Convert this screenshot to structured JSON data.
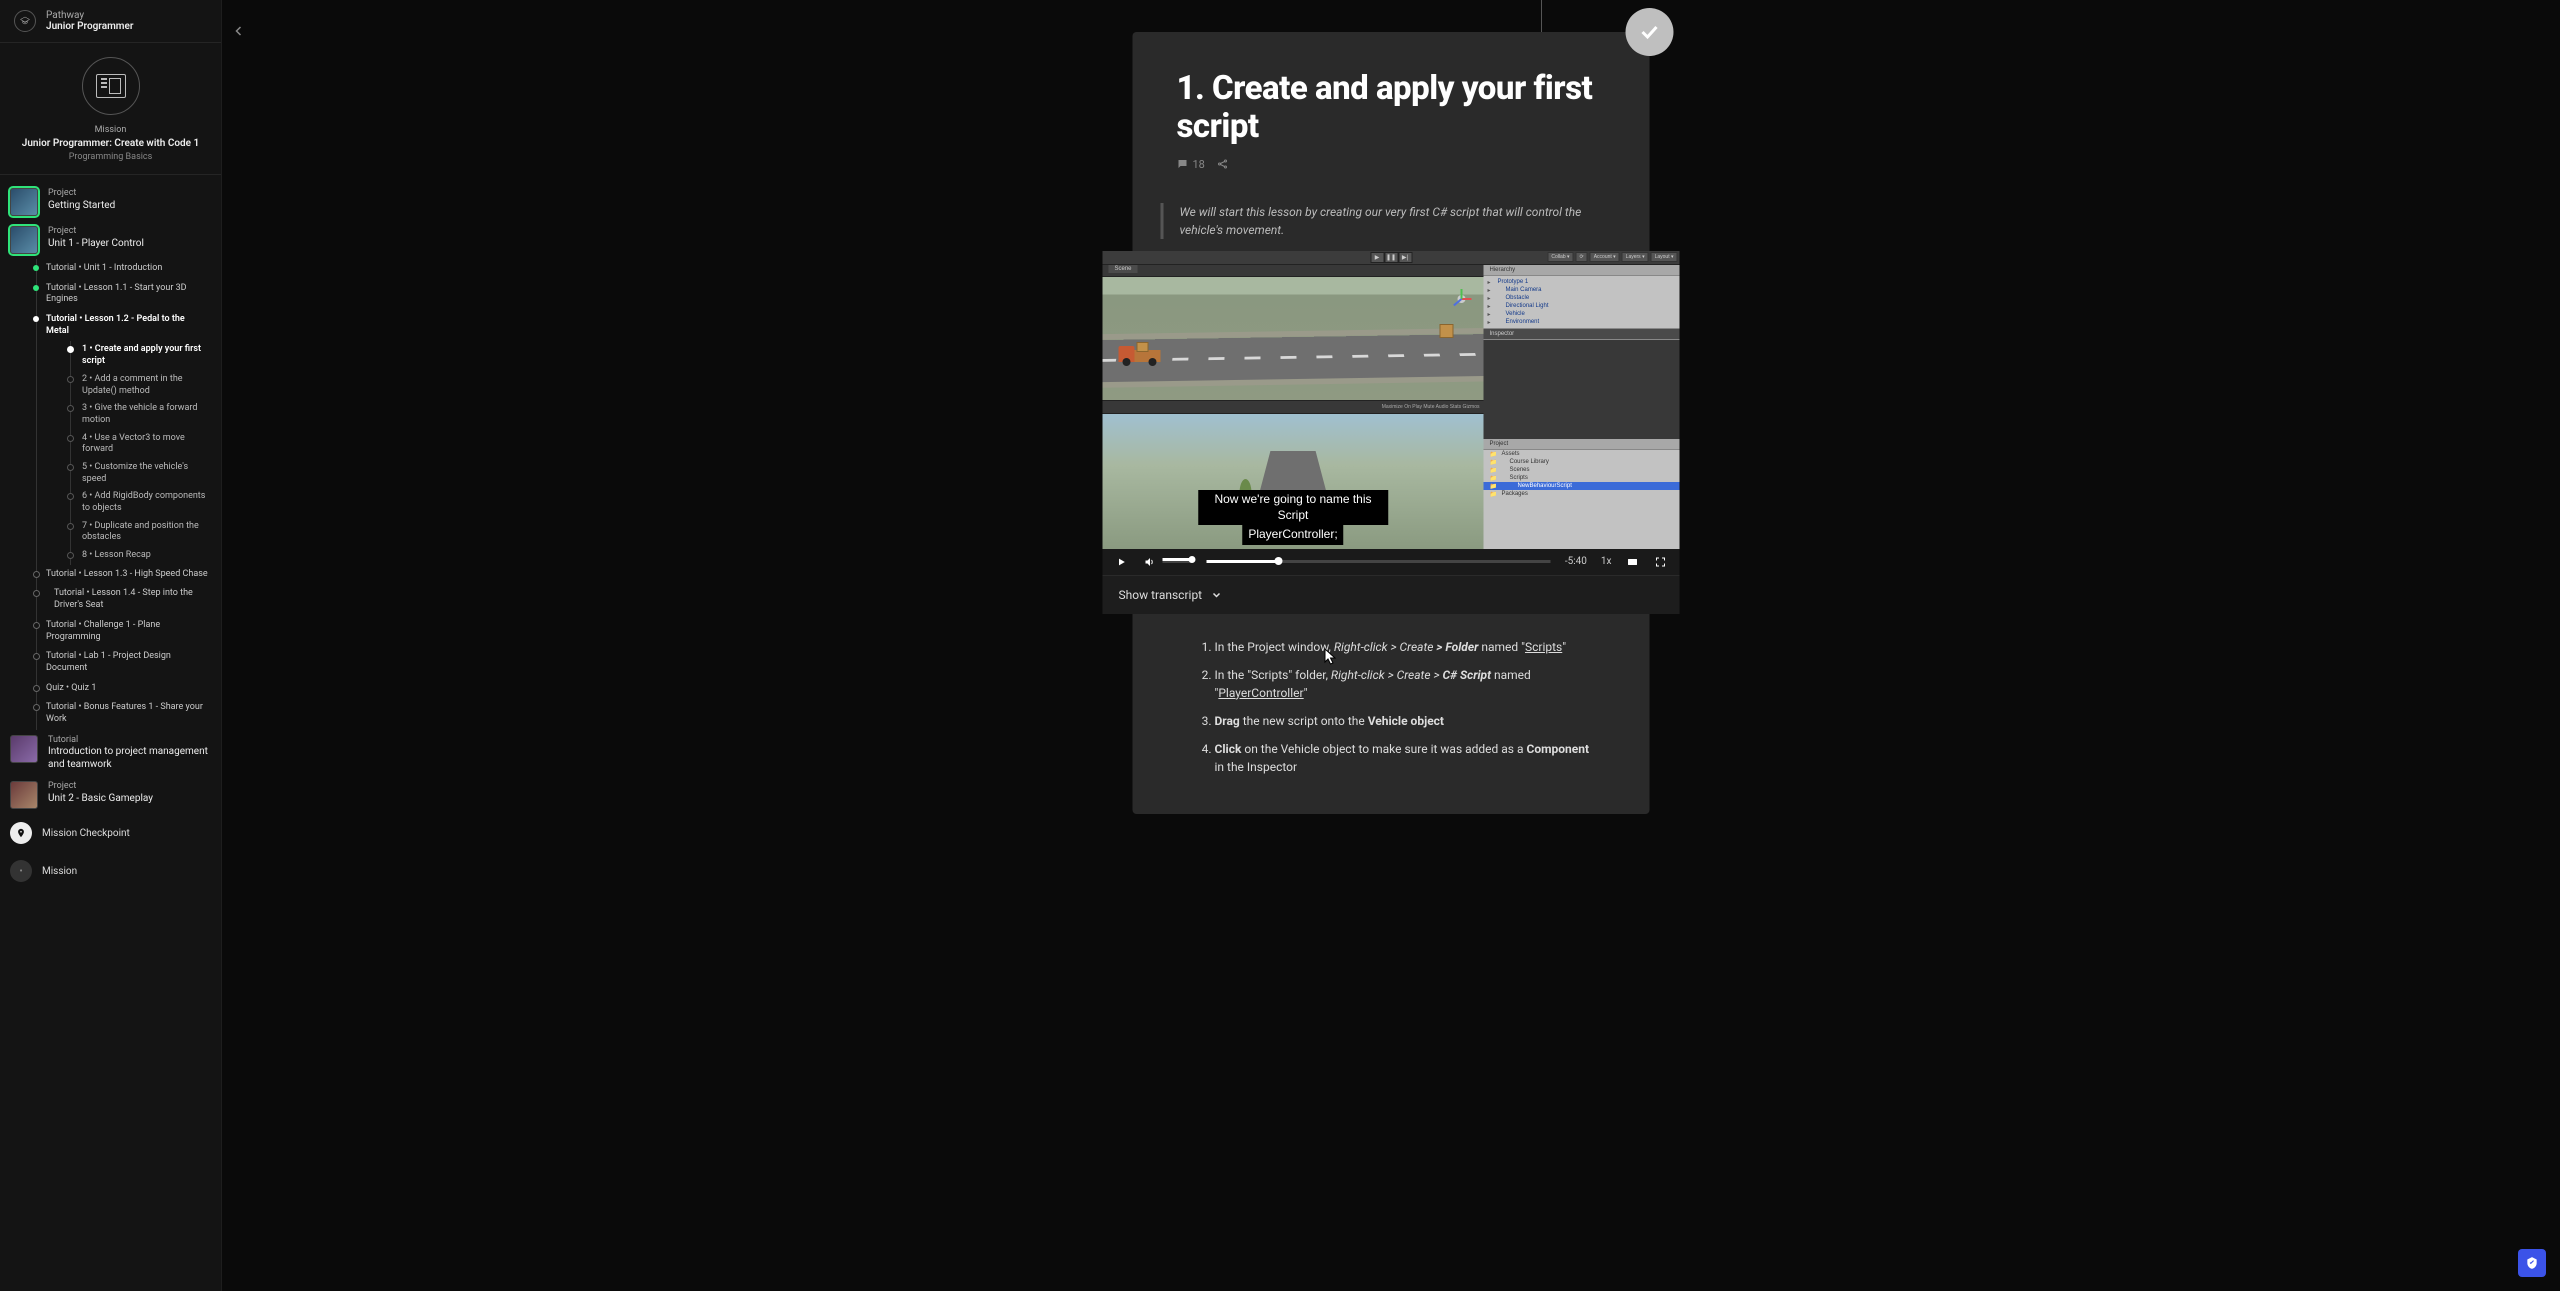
{
  "sidebar": {
    "pathway_label": "Pathway",
    "pathway_name": "Junior Programmer",
    "mission_label": "Mission",
    "mission_title": "Junior Programmer: Create with Code 1",
    "mission_sub": "Programming Basics",
    "nodes": {
      "getting_started": {
        "kind": "Project",
        "title": "Getting Started"
      },
      "unit1": {
        "kind": "Project",
        "title": "Unit 1 - Player Control"
      },
      "intro_pm": {
        "kind": "Tutorial",
        "title": "Introduction to project management and teamwork"
      },
      "unit2": {
        "kind": "Project",
        "title": "Unit 2 - Basic Gameplay"
      },
      "checkpoint": "Mission Checkpoint",
      "next_mission": "Mission"
    },
    "lessons": {
      "l0": "Tutorial • Unit 1 - Introduction",
      "l1": "Tutorial • Lesson 1.1 - Start your 3D Engines",
      "l2": "Tutorial • Lesson 1.2 - Pedal to the Metal",
      "l3": "Tutorial • Lesson 1.3 - High Speed Chase",
      "l4": "Tutorial • Lesson 1.4 - Step into the Driver's Seat",
      "l5": "Tutorial • Challenge 1 - Plane Programming",
      "l6": "Tutorial • Lab 1 - Project Design Document",
      "l7": "Quiz • Quiz 1",
      "l8": "Tutorial • Bonus Features 1 - Share your Work"
    },
    "steps": {
      "s1": "1 • Create and apply your first script",
      "s2": "2 • Add a comment in the Update() method",
      "s3": "3 • Give the vehicle a forward motion",
      "s4": "4 • Use a Vector3 to move forward",
      "s5": "5 • Customize the vehicle's speed",
      "s6": "6 • Add RigidBody components to objects",
      "s7": "7 • Duplicate and position the obstacles",
      "s8": "8 • Lesson Recap"
    }
  },
  "main": {
    "title": "1. Create and apply your first script",
    "comments": "18",
    "intro": "We will start this lesson by creating our very first C# script that will control the vehicle's movement.",
    "video": {
      "caption_l1": "Now we're going to name this Script",
      "caption_l2": "PlayerController;",
      "time_remaining": "-5:40",
      "speed": "1x",
      "transcript": "Show transcript",
      "hierarchy": [
        "Prototype 1",
        "Main Camera",
        "Obstacle",
        "Directional Light",
        "Vehicle",
        "Environment"
      ],
      "project_items": [
        "Assets",
        "Course Library",
        "Scenes",
        "Scripts",
        "NewBehaviourScript",
        "Packages"
      ],
      "game_bar": "Maximize On Play   Mute Audio   Stats   Gizmos",
      "topbar_right": [
        "Collab ▾",
        "⟳",
        "Account ▾",
        "Layers ▾",
        "Layout ▾"
      ]
    },
    "instructions": {
      "i1_pre": "In the Project window, ",
      "i1_em": "Right-click > Create",
      "i1_gt": " > ",
      "i1_b": "Folder",
      "i1_post": " named \"",
      "i1_u": "Scripts",
      "i1_end": "\"",
      "i2_pre": "In the \"Scripts\" folder, ",
      "i2_em": "Right-click  > Create > ",
      "i2_b": "C# Script",
      "i2_post": " named \"",
      "i2_u": "PlayerController",
      "i2_end": "\"",
      "i3_b1": "Drag",
      "i3_mid": " the new script onto the ",
      "i3_b2": "Vehicle object",
      "i4_b1": "Click",
      "i4_mid": " on the Vehicle object to make sure it was added as a ",
      "i4_b2": "Component",
      "i4_post": " in the Inspector"
    }
  }
}
